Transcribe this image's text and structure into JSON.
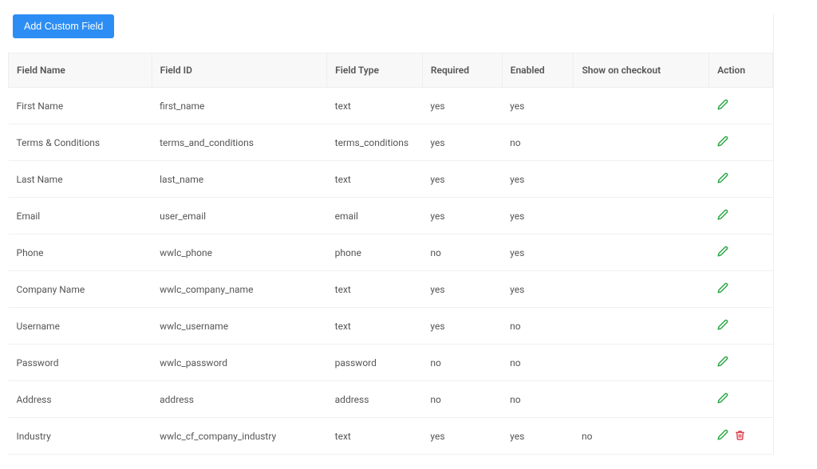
{
  "buttons": {
    "add_custom_field": "Add Custom Field"
  },
  "table": {
    "headers": {
      "field_name": "Field Name",
      "field_id": "Field ID",
      "field_type": "Field Type",
      "required": "Required",
      "enabled": "Enabled",
      "show_on_checkout": "Show on checkout",
      "action": "Action"
    },
    "rows": [
      {
        "name": "First Name",
        "id": "first_name",
        "type": "text",
        "required": "yes",
        "enabled": "yes",
        "show": "",
        "deletable": false
      },
      {
        "name": "Terms & Conditions",
        "id": "terms_and_conditions",
        "type": "terms_conditions",
        "required": "yes",
        "enabled": "no",
        "show": "",
        "deletable": false
      },
      {
        "name": "Last Name",
        "id": "last_name",
        "type": "text",
        "required": "yes",
        "enabled": "yes",
        "show": "",
        "deletable": false
      },
      {
        "name": "Email",
        "id": "user_email",
        "type": "email",
        "required": "yes",
        "enabled": "yes",
        "show": "",
        "deletable": false
      },
      {
        "name": "Phone",
        "id": "wwlc_phone",
        "type": "phone",
        "required": "no",
        "enabled": "yes",
        "show": "",
        "deletable": false
      },
      {
        "name": "Company Name",
        "id": "wwlc_company_name",
        "type": "text",
        "required": "yes",
        "enabled": "yes",
        "show": "",
        "deletable": false
      },
      {
        "name": "Username",
        "id": "wwlc_username",
        "type": "text",
        "required": "yes",
        "enabled": "no",
        "show": "",
        "deletable": false
      },
      {
        "name": "Password",
        "id": "wwlc_password",
        "type": "password",
        "required": "no",
        "enabled": "no",
        "show": "",
        "deletable": false
      },
      {
        "name": "Address",
        "id": "address",
        "type": "address",
        "required": "no",
        "enabled": "no",
        "show": "",
        "deletable": false
      },
      {
        "name": "Industry",
        "id": "wwlc_cf_company_industry",
        "type": "text",
        "required": "yes",
        "enabled": "yes",
        "show": "no",
        "deletable": true
      }
    ]
  }
}
